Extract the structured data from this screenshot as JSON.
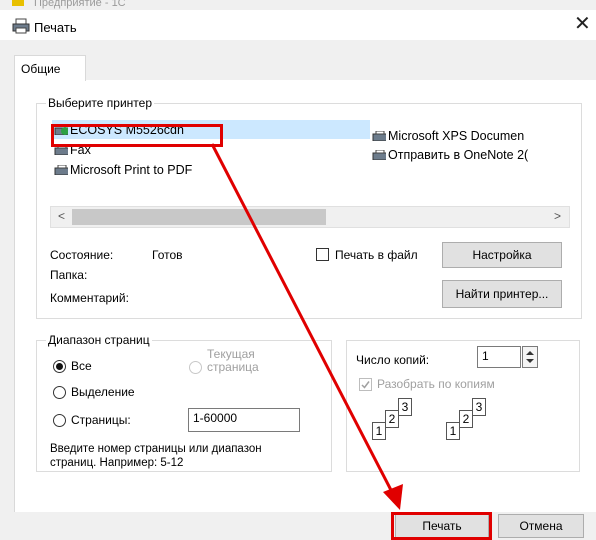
{
  "background_window_text": "Предприятие - 1С",
  "dialog": {
    "title": "Печать",
    "close_glyph": "✕"
  },
  "tabs": [
    {
      "label": "Общие"
    }
  ],
  "printer_group": {
    "label": "Выберите принтер",
    "printers": [
      {
        "name": "ECOSYS M5526cdn",
        "selected": true
      },
      {
        "name": "Fax"
      },
      {
        "name": "Microsoft Print to PDF"
      },
      {
        "name": "Microsoft XPS Documen"
      },
      {
        "name": "Отправить в OneNote 2("
      }
    ],
    "scroll_left": "<",
    "scroll_right": ">",
    "status_label": "Состояние:",
    "status_value": "Готов",
    "folder_label": "Папка:",
    "comment_label": "Комментарий:",
    "print_to_file_label": "Печать в файл",
    "settings_button": "Настройка",
    "find_printer_button": "Найти принтер..."
  },
  "range_group": {
    "label": "Диапазон страниц",
    "all_label": "Все",
    "current_page_label_1": "Текущая",
    "current_page_label_2": "страница",
    "selection_label": "Выделение",
    "pages_label": "Страницы:",
    "pages_value": "1-60000",
    "hint_1": "Введите номер страницы или диапазон",
    "hint_2": "страниц.  Например: 5-12"
  },
  "copies_group": {
    "copies_label": "Число копий:",
    "copies_value": "1",
    "collate_label": "Разобрать по копиям",
    "collate_checked": true,
    "collate_pages": [
      "1",
      "2",
      "3",
      "1",
      "2",
      "3"
    ]
  },
  "buttons": {
    "print": "Печать",
    "cancel": "Отмена"
  },
  "annotation_color": "#e00000"
}
